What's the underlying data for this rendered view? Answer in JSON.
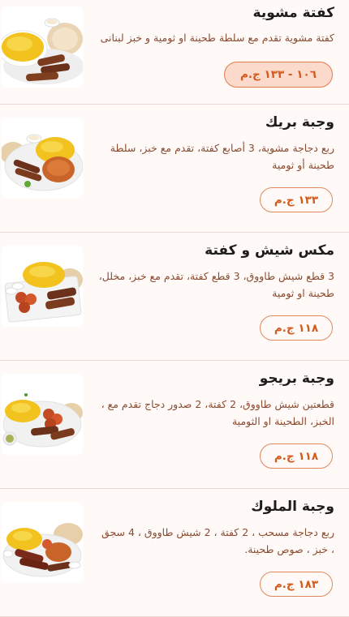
{
  "menu": {
    "items": [
      {
        "title": "كفتة مشوية",
        "description": "كفتة مشوية تقدم مع سلطة طحينة او ثومية و خبز لبنانى",
        "price": "١٠٦ - ١٣٣ ج.م",
        "image_icon": "grilled-kofta-plate-image"
      },
      {
        "title": "وجبة بريك",
        "description": "ربع دجاجة مشوية، 3 أصابع كفتة، تقدم مع خبز، سلطة طحينة أو ثومية",
        "price": "١٣٣ ج.م",
        "image_icon": "break-meal-plate-image"
      },
      {
        "title": "مكس شيش و كفتة",
        "description": "3 قطع شيش طاووق، 3 قطع كفتة، تقدم مع خبز، مخلل، طحينة او ثومية",
        "price": "١١٨ ج.م",
        "image_icon": "mix-shish-kofta-plate-image"
      },
      {
        "title": "وجبة بريجو",
        "description": "قطعتين شيش طاووق، 2 كفتة، 2 صدور دجاج تقدم مع ، الخبز، الطحينة او الثومية",
        "price": "١١٨ ج.م",
        "image_icon": "brego-meal-plate-image"
      },
      {
        "title": "وجبة الملوك",
        "description": "ربع دجاجة مسحب ، 2 كفتة ، 2 شيش طاووق ، 4 سجق ، خبز ، صوص طحينة.",
        "price": "١٨٣ ج.م",
        "image_icon": "kings-meal-plate-image"
      }
    ]
  },
  "colors": {
    "accent": "#d25a1d",
    "description_text": "#8a4b30",
    "selected_pill_bg": "#fbd9cb"
  }
}
